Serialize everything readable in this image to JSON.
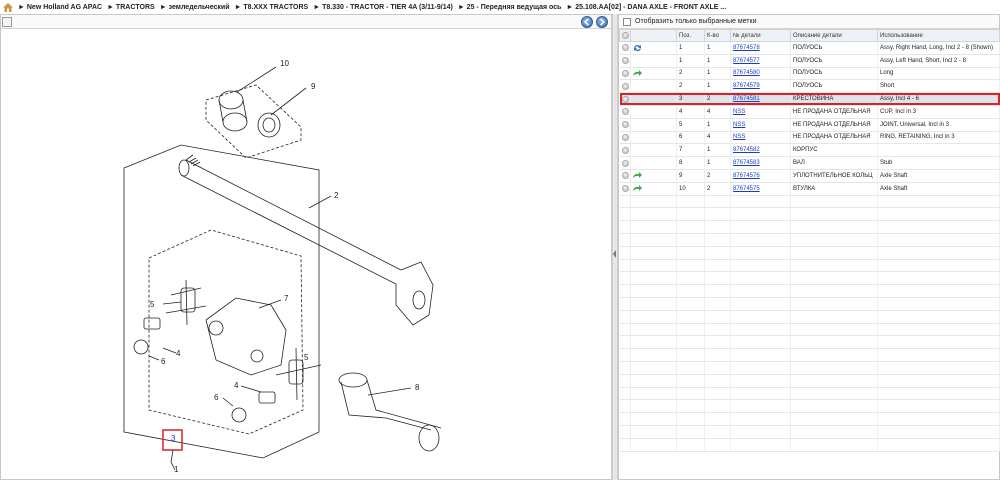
{
  "breadcrumb": {
    "items": [
      "► New Holland AG APAC",
      "► TRACTORS",
      "► земледельческий",
      "► T8.XXX TRACTORS",
      "► T8.330 - TRACTOR - TIER 4A (3/11-9/14)",
      "► 25 - Передняя ведущая ось",
      "► 25.108.AA[02] - DANA AXLE - FRONT AXLE ..."
    ]
  },
  "filter": {
    "label": "Отобразить только выбранные метки"
  },
  "table": {
    "headers": [
      "",
      "",
      "Поз.",
      "К-во",
      "№ детали",
      "Описание детали",
      "Использование"
    ],
    "rows": [
      {
        "icon": "refresh-blue",
        "pos": "1",
        "qty": "1",
        "part": "87674578",
        "desc": "ПОЛУОСЬ",
        "use": "Assy, Right Hand, Long, Incl 2 - 8 (Shown)"
      },
      {
        "icon": "",
        "pos": "1",
        "qty": "1",
        "part": "87674577",
        "desc": "ПОЛУОСЬ",
        "use": "Assy, Left Hand, Short, Incl 2 - 8"
      },
      {
        "icon": "arrow-green",
        "pos": "2",
        "qty": "1",
        "part": "87674580",
        "desc": "ПОЛУОСЬ",
        "use": "Long"
      },
      {
        "icon": "",
        "pos": "2",
        "qty": "1",
        "part": "87674579",
        "desc": "ПОЛУОСЬ",
        "use": "Short"
      },
      {
        "icon": "",
        "pos": "3",
        "qty": "2",
        "part": "87674581",
        "desc": "КРЕСТОВИНА",
        "use": "Assy, Incl 4 - 6",
        "selected": true
      },
      {
        "icon": "",
        "pos": "4",
        "qty": "4",
        "part": "NSS",
        "desc": "НЕ ПРОДАНА ОТДЕЛЬНАЯ",
        "use": "CUP, Incl in 3"
      },
      {
        "icon": "",
        "pos": "5",
        "qty": "1",
        "part": "NSS",
        "desc": "НЕ ПРОДАНА ОТДЕЛЬНАЯ",
        "use": "JOINT, Universal, Incl in 3"
      },
      {
        "icon": "",
        "pos": "6",
        "qty": "4",
        "part": "NSS",
        "desc": "НЕ ПРОДАНА ОТДЕЛЬНАЯ",
        "use": "RING, RETAINING, Incl in 3"
      },
      {
        "icon": "",
        "pos": "7",
        "qty": "1",
        "part": "87674582",
        "desc": "КОРПУС",
        "use": ""
      },
      {
        "icon": "",
        "pos": "8",
        "qty": "1",
        "part": "87674583",
        "desc": "ВАЛ",
        "use": "Stub"
      },
      {
        "icon": "arrow-green",
        "pos": "9",
        "qty": "2",
        "part": "87674576",
        "desc": "УПЛОТНИТЕЛЬНОЕ КОЛЬЦ",
        "use": "Axle Shaft"
      },
      {
        "icon": "arrow-green",
        "pos": "10",
        "qty": "2",
        "part": "87674575",
        "desc": "ВТУЛКА",
        "use": "Axle Shaft"
      }
    ]
  },
  "diagram": {
    "callouts": [
      "10",
      "9",
      "2",
      "7",
      "5",
      "4",
      "6",
      "8",
      "4",
      "6",
      "3",
      "1",
      "5"
    ]
  },
  "colors": {
    "highlight": "#d8222a",
    "link": "#1a3ec9"
  }
}
